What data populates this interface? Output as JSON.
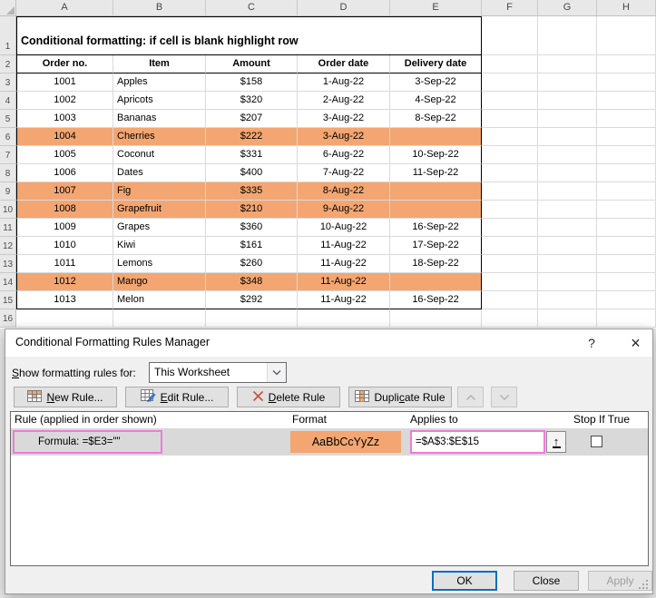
{
  "spreadsheet": {
    "column_headers": [
      "A",
      "B",
      "C",
      "D",
      "E",
      "F",
      "G",
      "H"
    ],
    "row_numbers": [
      "1",
      "2",
      "3",
      "4",
      "5",
      "6",
      "7",
      "8",
      "9",
      "10",
      "11",
      "12",
      "13",
      "14",
      "15",
      "16"
    ],
    "title": "Conditional formatting: if cell is blank highlight row",
    "table": {
      "headers": [
        "Order no.",
        "Item",
        "Amount",
        "Order date",
        "Delivery date"
      ],
      "rows": [
        {
          "order_no": "1001",
          "item": "Apples",
          "amount": "$158",
          "order_date": "1-Aug-22",
          "delivery_date": "3-Sep-22",
          "highlighted": false
        },
        {
          "order_no": "1002",
          "item": "Apricots",
          "amount": "$320",
          "order_date": "2-Aug-22",
          "delivery_date": "4-Sep-22",
          "highlighted": false
        },
        {
          "order_no": "1003",
          "item": "Bananas",
          "amount": "$207",
          "order_date": "3-Aug-22",
          "delivery_date": "8-Sep-22",
          "highlighted": false
        },
        {
          "order_no": "1004",
          "item": "Cherries",
          "amount": "$222",
          "order_date": "3-Aug-22",
          "delivery_date": "",
          "highlighted": true
        },
        {
          "order_no": "1005",
          "item": "Coconut",
          "amount": "$331",
          "order_date": "6-Aug-22",
          "delivery_date": "10-Sep-22",
          "highlighted": false
        },
        {
          "order_no": "1006",
          "item": "Dates",
          "amount": "$400",
          "order_date": "7-Aug-22",
          "delivery_date": "11-Sep-22",
          "highlighted": false
        },
        {
          "order_no": "1007",
          "item": "Fig",
          "amount": "$335",
          "order_date": "8-Aug-22",
          "delivery_date": "",
          "highlighted": true
        },
        {
          "order_no": "1008",
          "item": "Grapefruit",
          "amount": "$210",
          "order_date": "9-Aug-22",
          "delivery_date": "",
          "highlighted": true
        },
        {
          "order_no": "1009",
          "item": "Grapes",
          "amount": "$360",
          "order_date": "10-Aug-22",
          "delivery_date": "16-Sep-22",
          "highlighted": false
        },
        {
          "order_no": "1010",
          "item": "Kiwi",
          "amount": "$161",
          "order_date": "11-Aug-22",
          "delivery_date": "17-Sep-22",
          "highlighted": false
        },
        {
          "order_no": "1011",
          "item": "Lemons",
          "amount": "$260",
          "order_date": "11-Aug-22",
          "delivery_date": "18-Sep-22",
          "highlighted": false
        },
        {
          "order_no": "1012",
          "item": "Mango",
          "amount": "$348",
          "order_date": "11-Aug-22",
          "delivery_date": "",
          "highlighted": true
        },
        {
          "order_no": "1013",
          "item": "Melon",
          "amount": "$292",
          "order_date": "11-Aug-22",
          "delivery_date": "16-Sep-22",
          "highlighted": false
        }
      ]
    },
    "highlight_color": "#F3A671"
  },
  "dialog": {
    "title": "Conditional Formatting Rules Manager",
    "help_label": "?",
    "close_label": "×",
    "show_rules": {
      "pre": "",
      "key": "S",
      "post": "how formatting rules for:"
    },
    "scope_value": "This Worksheet",
    "toolbar": {
      "new_rule": {
        "pre": "",
        "key": "N",
        "post": "ew Rule..."
      },
      "edit_rule": {
        "pre": "",
        "key": "E",
        "post": "dit Rule..."
      },
      "delete_rule": {
        "pre": "",
        "key": "D",
        "post": "elete Rule"
      },
      "duplicate_rule": {
        "pre": "Dupli",
        "key": "c",
        "post": "ate Rule"
      }
    },
    "list": {
      "columns": {
        "rule": "Rule (applied in order shown)",
        "format": "Format",
        "applies_to": "Applies to",
        "stop_if_true": "Stop If True"
      },
      "rule": {
        "description": "Formula: =$E3=\"\"",
        "format_preview": "AaBbCcYyZz",
        "applies_to": "=$A$3:$E$15",
        "stop_if_true_checked": false
      }
    },
    "footer": {
      "ok": "OK",
      "close": "Close",
      "apply": "Apply"
    },
    "annotation_color": "#ED7BDB"
  }
}
